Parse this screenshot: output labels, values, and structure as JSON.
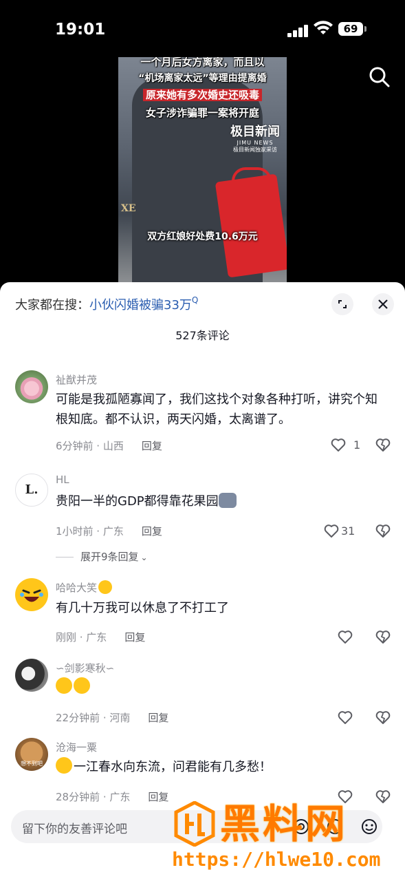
{
  "status_bar": {
    "time": "19:01",
    "battery": "69"
  },
  "video": {
    "captions": [
      "一个月后女方离家，而且以",
      "“机场离家太远”等理由提离婚",
      "原来她有多次婚史还吸毒",
      "女子涉诈骗罪一案将开庭"
    ],
    "brand": "极目新闻",
    "brand_en": "JIMU NEWS",
    "brand_note": "极目新闻独家采访",
    "fee_caption": "双方红娘好处费10.6万元",
    "bag_text": "XE"
  },
  "comments_panel": {
    "hot_search_prefix": "大家都在搜：",
    "hot_search_keyword": "小伙闪婚被骗33万",
    "hot_search_q": "Q",
    "count_label": "527条评论",
    "reply_label": "回复",
    "comments": [
      {
        "user": "祉猷并茂",
        "text": "可能是我孤陋寡闻了，我们这找个对象各种打听，讲究个知根知底。都不认识，两天闪婚，太离谱了。",
        "time_loc": "6分钟前 · 山西",
        "likes": "1"
      },
      {
        "user": "HL",
        "text": "贵阳一半的GDP都得靠花果园",
        "time_loc": "1小时前 · 广东",
        "likes": "31",
        "expand": "展开9条回复",
        "avatar_text": "L."
      },
      {
        "user": "哈哈大笑",
        "text": "有几十万我可以休息了不打工了",
        "time_loc": "刚刚 · 广东",
        "likes": ""
      },
      {
        "user": "剑影寒秋",
        "text": "",
        "time_loc": "22分钟前 · 河南",
        "likes": ""
      },
      {
        "user": "沧海一粟",
        "text": "一江春水向东流，问君能有几多愁！",
        "time_loc": "28分钟前 · 广东",
        "likes": "",
        "avatar_text": "想不到吧"
      }
    ],
    "input_placeholder": "留下你的友善评论吧"
  },
  "watermark": {
    "title": "黑料网",
    "url": "https://hlwe10.com"
  }
}
